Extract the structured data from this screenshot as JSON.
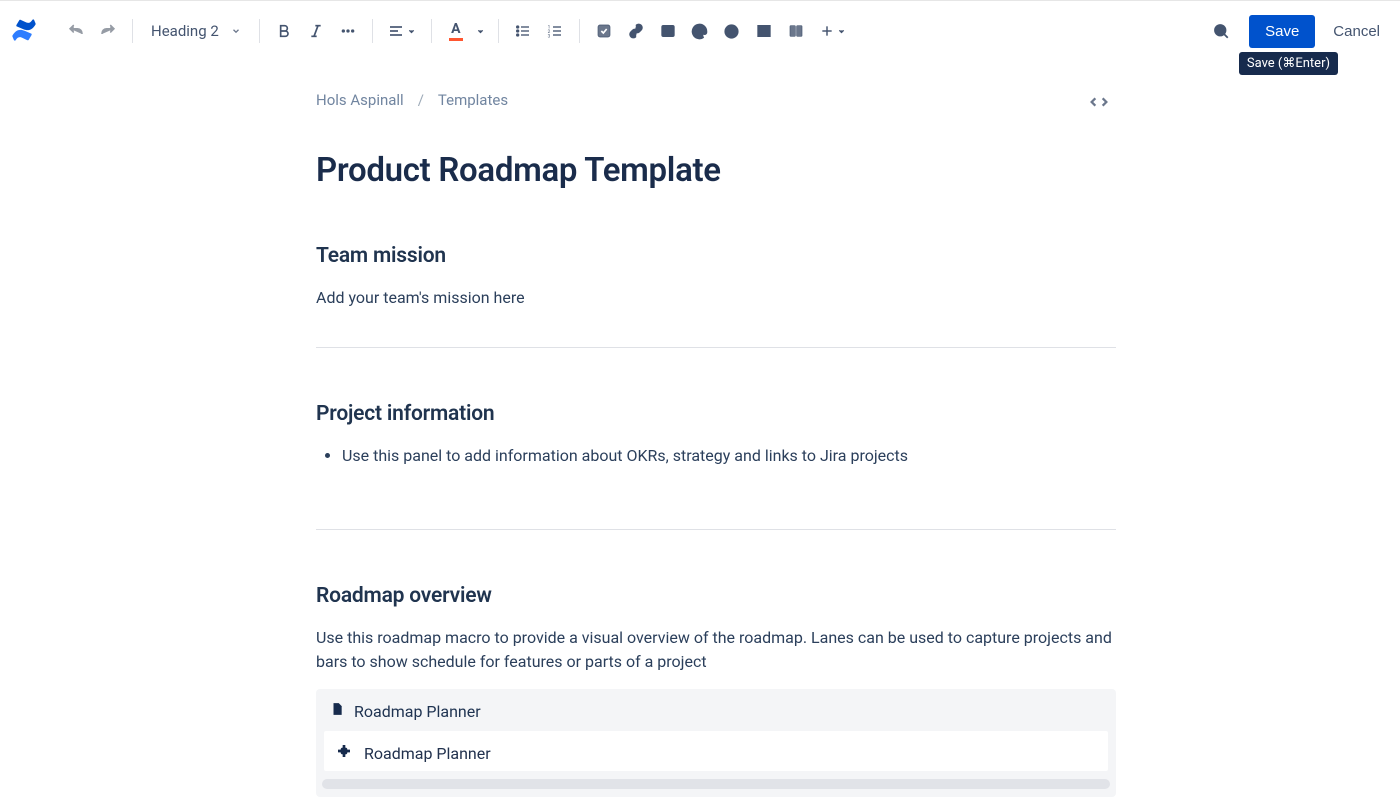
{
  "toolbar": {
    "heading_label": "Heading 2",
    "save_label": "Save",
    "cancel_label": "Cancel",
    "save_tooltip": "Save (⌘Enter)"
  },
  "breadcrumb": {
    "author": "Hols Aspinall",
    "section": "Templates"
  },
  "page": {
    "title": "Product Roadmap Template",
    "sections": {
      "mission": {
        "heading": "Team mission",
        "text": "Add your team's mission here"
      },
      "project_info": {
        "heading": "Project information",
        "bullet1": "Use this panel to add information about OKRs, strategy and links to Jira projects"
      },
      "roadmap": {
        "heading": "Roadmap overview",
        "text": "Use this roadmap macro to provide a visual overview of the roadmap. Lanes can be used to capture projects and bars to show schedule for features or parts of a project",
        "macro_title": "Roadmap Planner",
        "macro_inner": "Roadmap Planner"
      }
    }
  }
}
